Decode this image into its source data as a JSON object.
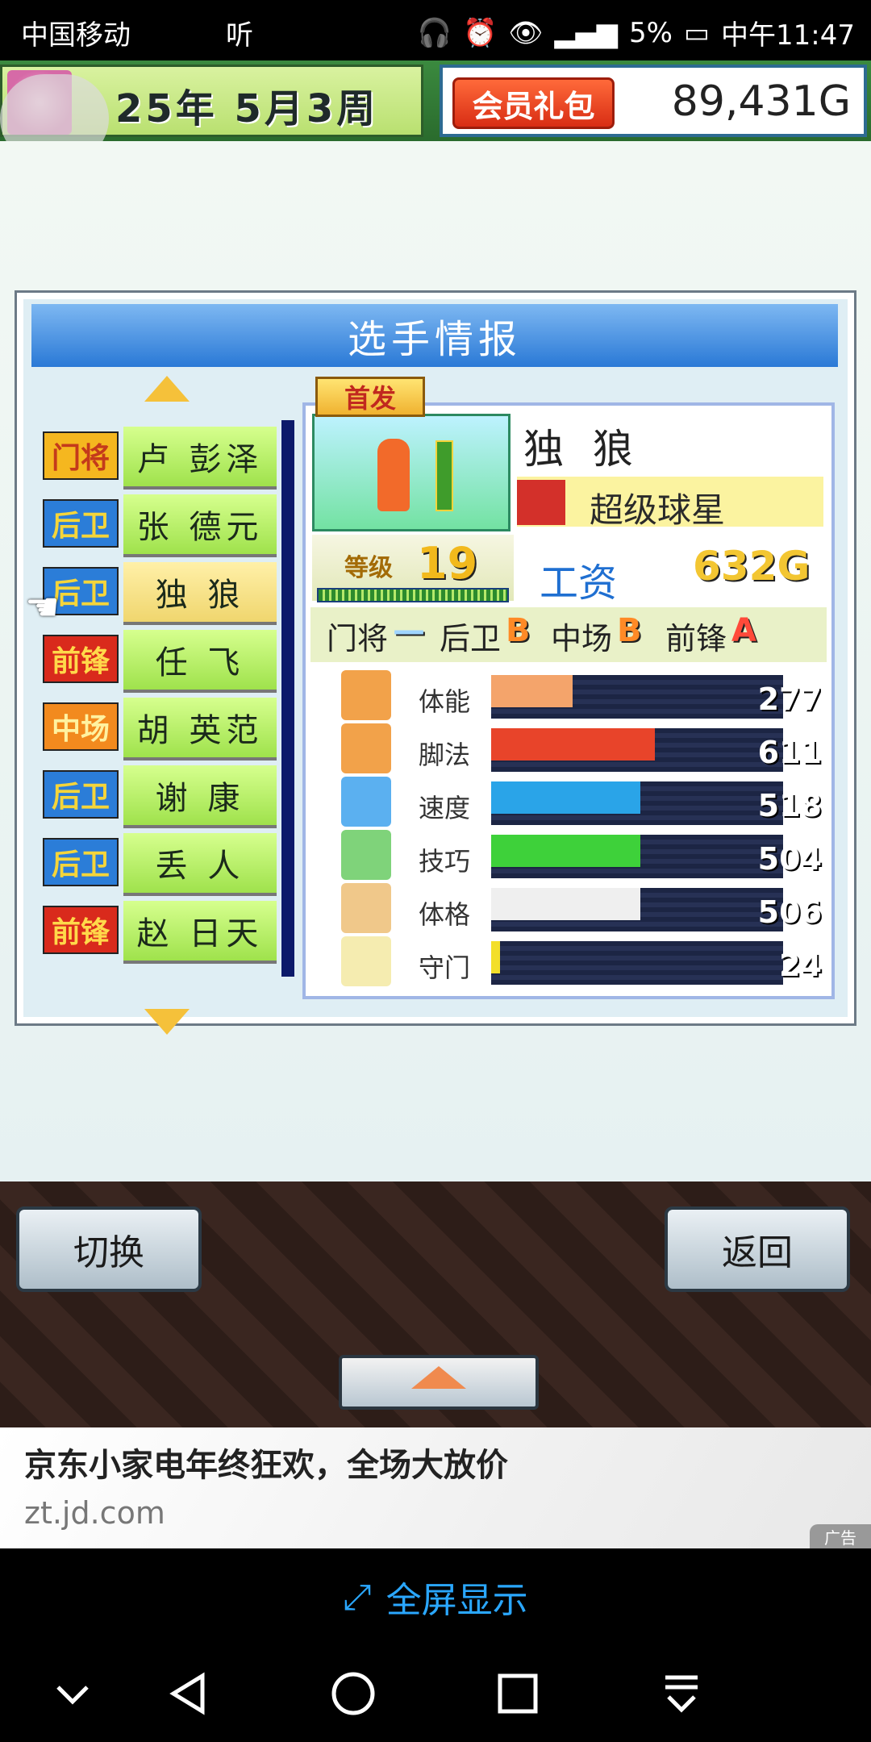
{
  "status_bar": {
    "carrier": "中国移动",
    "app_hint": "听",
    "battery": "5%",
    "time": "中午11:47"
  },
  "game": {
    "date": "25年 5月3周",
    "vip_label": "会员礼包",
    "money": "89,431G",
    "panel_title": "选手情报",
    "players": [
      {
        "pos": "门将",
        "name": "卢 彭泽",
        "pos_color": "#f5b71f",
        "pos_text": "#c43a1b"
      },
      {
        "pos": "后卫",
        "name": "张 德元",
        "pos_color": "#2b7dd8",
        "pos_text": "#f5d53a"
      },
      {
        "pos": "后卫",
        "name": "独 狼",
        "pos_color": "#2b7dd8",
        "pos_text": "#f5d53a",
        "selected": true
      },
      {
        "pos": "前锋",
        "name": "任 飞",
        "pos_color": "#d92a1c",
        "pos_text": "#ffd94a"
      },
      {
        "pos": "中场",
        "name": "胡 英范",
        "pos_color": "#f28a1e",
        "pos_text": "#fff2a0"
      },
      {
        "pos": "后卫",
        "name": "谢 康",
        "pos_color": "#2b7dd8",
        "pos_text": "#f5d53a"
      },
      {
        "pos": "后卫",
        "name": "丢 人",
        "pos_color": "#2b7dd8",
        "pos_text": "#f5d53a"
      },
      {
        "pos": "前锋",
        "name": "赵 日天",
        "pos_color": "#d92a1c",
        "pos_text": "#ffd94a"
      }
    ],
    "detail": {
      "badge": "首发",
      "name": "独 狼",
      "role": "超级球星",
      "level_label": "等级",
      "level": "19",
      "salary_label": "工资",
      "salary": "632G",
      "aptitudes": [
        {
          "label": "门将",
          "grade": "—"
        },
        {
          "label": "后卫",
          "grade": "B"
        },
        {
          "label": "中场",
          "grade": "B"
        },
        {
          "label": "前锋",
          "grade": "A"
        }
      ],
      "stats": [
        {
          "label": "体能",
          "value": "277",
          "fill": 0.28,
          "color": "#f4a46b",
          "icon": "battery-icon"
        },
        {
          "label": "脚法",
          "value": "611",
          "fill": 0.56,
          "color": "#e8442a",
          "icon": "boot-icon"
        },
        {
          "label": "速度",
          "value": "518",
          "fill": 0.51,
          "color": "#2aa4e8",
          "icon": "runner-icon"
        },
        {
          "label": "技巧",
          "value": "504",
          "fill": 0.51,
          "color": "#3ed13a",
          "icon": "dribble-icon"
        },
        {
          "label": "体格",
          "value": "506",
          "fill": 0.51,
          "color": "#efefef",
          "icon": "muscle-icon"
        },
        {
          "label": "守门",
          "value": "24",
          "fill": 0.03,
          "color": "#f3df2a",
          "icon": "glove-icon"
        }
      ]
    },
    "buttons": {
      "switch": "切换",
      "back": "返回"
    }
  },
  "ad": {
    "title": "京东小家电年终狂欢，全场大放价",
    "url": "zt.jd.com",
    "tag": "广告"
  },
  "fullscreen_label": "全屏显示"
}
